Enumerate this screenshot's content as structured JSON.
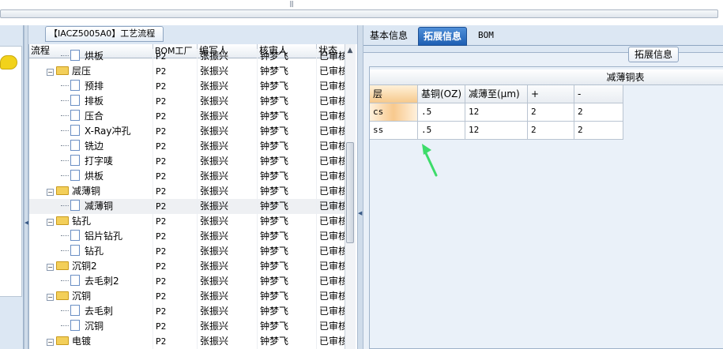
{
  "colors": {
    "accent": "#1f5fb3",
    "pane_bg": "#dce7f3",
    "highlight": "#f8c98e",
    "annotation_arrow": "#3ddc6a"
  },
  "process_panel": {
    "tab_title": "【IACZ5005A0】工艺流程",
    "columns": [
      "流程",
      "BOM工厂",
      "编写人",
      "核审人",
      "状态"
    ],
    "rows": [
      {
        "kind": "leaf",
        "name": "烘板",
        "bom": "P2",
        "writer": "张振兴",
        "checker": "钟梦飞",
        "status": "已审核"
      },
      {
        "kind": "folder",
        "name": "层压",
        "bom": "P2",
        "writer": "张振兴",
        "checker": "钟梦飞",
        "status": "已审核"
      },
      {
        "kind": "leaf",
        "name": "预排",
        "bom": "P2",
        "writer": "张振兴",
        "checker": "钟梦飞",
        "status": "已审核"
      },
      {
        "kind": "leaf",
        "name": "排板",
        "bom": "P2",
        "writer": "张振兴",
        "checker": "钟梦飞",
        "status": "已审核"
      },
      {
        "kind": "leaf",
        "name": "压合",
        "bom": "P2",
        "writer": "张振兴",
        "checker": "钟梦飞",
        "status": "已审核"
      },
      {
        "kind": "leaf",
        "name": "X-Ray冲孔",
        "bom": "P2",
        "writer": "张振兴",
        "checker": "钟梦飞",
        "status": "已审核"
      },
      {
        "kind": "leaf",
        "name": "铣边",
        "bom": "P2",
        "writer": "张振兴",
        "checker": "钟梦飞",
        "status": "已审核"
      },
      {
        "kind": "leaf",
        "name": "打字唛",
        "bom": "P2",
        "writer": "张振兴",
        "checker": "钟梦飞",
        "status": "已审核"
      },
      {
        "kind": "leaf",
        "name": "烘板",
        "bom": "P2",
        "writer": "张振兴",
        "checker": "钟梦飞",
        "status": "已审核"
      },
      {
        "kind": "folder",
        "name": "减薄铜",
        "bom": "P2",
        "writer": "张振兴",
        "checker": "钟梦飞",
        "status": "已审核"
      },
      {
        "kind": "leaf",
        "name": "减薄铜",
        "bom": "P2",
        "writer": "张振兴",
        "checker": "钟梦飞",
        "status": "已审核",
        "selected": true
      },
      {
        "kind": "folder",
        "name": "钻孔",
        "bom": "P2",
        "writer": "张振兴",
        "checker": "钟梦飞",
        "status": "已审核"
      },
      {
        "kind": "leaf",
        "name": "铝片钻孔",
        "bom": "P2",
        "writer": "张振兴",
        "checker": "钟梦飞",
        "status": "已审核"
      },
      {
        "kind": "leaf",
        "name": "钻孔",
        "bom": "P2",
        "writer": "张振兴",
        "checker": "钟梦飞",
        "status": "已审核"
      },
      {
        "kind": "folder",
        "name": "沉铜2",
        "bom": "P2",
        "writer": "张振兴",
        "checker": "钟梦飞",
        "status": "已审核"
      },
      {
        "kind": "leaf",
        "name": "去毛刺2",
        "bom": "P2",
        "writer": "张振兴",
        "checker": "钟梦飞",
        "status": "已审核"
      },
      {
        "kind": "folder",
        "name": "沉铜",
        "bom": "P2",
        "writer": "张振兴",
        "checker": "钟梦飞",
        "status": "已审核"
      },
      {
        "kind": "leaf",
        "name": "去毛刺",
        "bom": "P2",
        "writer": "张振兴",
        "checker": "钟梦飞",
        "status": "已审核"
      },
      {
        "kind": "leaf",
        "name": "沉铜",
        "bom": "P2",
        "writer": "张振兴",
        "checker": "钟梦飞",
        "status": "已审核"
      },
      {
        "kind": "folder",
        "name": "电镀",
        "bom": "P2",
        "writer": "张振兴",
        "checker": "钟梦飞",
        "status": "已审核"
      }
    ]
  },
  "right_panel": {
    "tabs": [
      {
        "label": "基本信息",
        "active": false
      },
      {
        "label": "拓展信息",
        "active": true
      },
      {
        "label": "BOM",
        "active": false
      }
    ],
    "section_caption": "拓展信息",
    "table": {
      "title": "减薄铜表",
      "columns": [
        "层",
        "基铜(OZ)",
        "减薄至(μm)",
        "+",
        "-"
      ],
      "rows": [
        [
          "cs",
          ".5",
          "12",
          "2",
          "2"
        ],
        [
          "ss",
          ".5",
          "12",
          "2",
          "2"
        ]
      ]
    }
  }
}
